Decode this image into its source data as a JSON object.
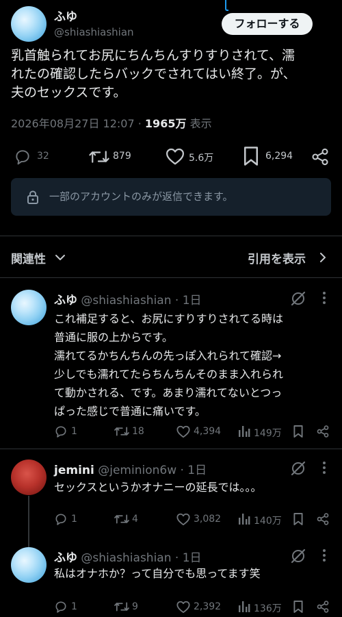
{
  "post": {
    "display_name": "ふゆ",
    "handle": "@shiashiashian",
    "follow_label": "フォローする",
    "body": "乳首触られてお尻にちんちんすりすりされて、濡\nれたの確認したらバックでされてはい終了。が、\n夫のセックスです。",
    "timestamp": "2026年08月27日 12:07",
    "separator": "·",
    "views": "1965万",
    "views_label": "表示",
    "stats": {
      "replies": "32",
      "reposts": "879",
      "likes": "5.6万",
      "bookmarks": "6,294"
    }
  },
  "reply_restriction": "一部のアカウントのみが返信できます。",
  "sort": {
    "label": "関連性",
    "quotes_label": "引用を表示"
  },
  "replies": [
    {
      "display_name": "ふゆ",
      "handle": "@shiashiashian",
      "time": "· 1日",
      "body": "これ補足すると、お尻にすりすりされてる時は\n普通に服の上からです。\n濡れてるかちんちんの先っぽ入れられて確認→\n少しでも濡れてたらちんちんそのまま入れられ\nて動かされる、です。あまり濡れてないとつっ\nぱった感じで普通に痛いです。",
      "stats": {
        "replies": "1",
        "reposts": "18",
        "likes": "4,394",
        "views": "149万"
      }
    },
    {
      "display_name": "jemini",
      "handle": "@jeminion6w",
      "time": "· 1日",
      "body": "セックスというかオナニーの延長では。。。",
      "stats": {
        "replies": "1",
        "reposts": "4",
        "likes": "3,082",
        "views": "140万"
      }
    },
    {
      "display_name": "ふゆ",
      "handle": "@shiashiashian",
      "time": "· 1日",
      "body": "私はオナホか？って自分でも思ってます笑",
      "stats": {
        "replies": "1",
        "reposts": "9",
        "likes": "2,392",
        "views": "136万"
      }
    }
  ],
  "colors": {
    "background": "#000000",
    "text": "#e7e9ea",
    "muted": "#71767b",
    "divider": "#2f3336",
    "reply_box": "#15202b",
    "follow_button": "#eff3f4"
  }
}
